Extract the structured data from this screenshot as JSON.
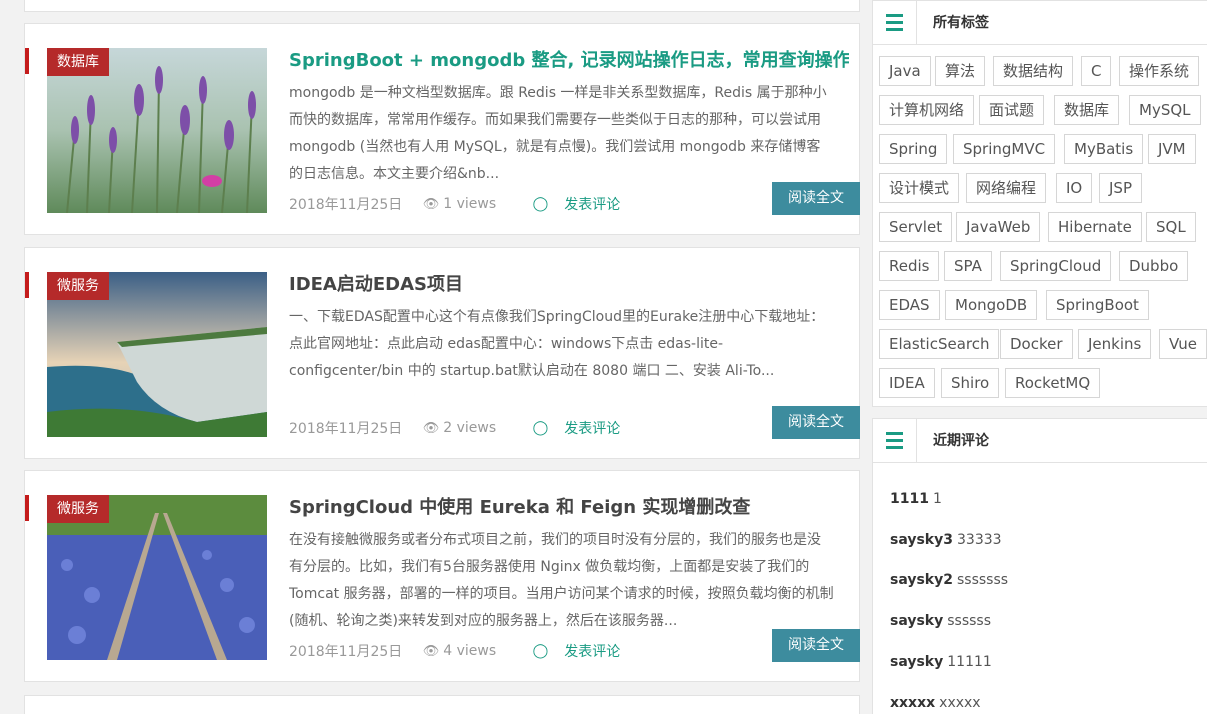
{
  "articles": [
    {
      "category": "数据库",
      "title": "SpringBoot + mongodb 整合, 记录网站操作日志，常用查询操作",
      "summary": "mongodb 是一种文档型数据库。跟 Redis 一样是非关系型数据库，Redis 属于那种小而快的数据库，常常用作缓存。而如果我们需要存一些类似于日志的那种，可以尝试用 mongodb (当然也有人用 MySQL，就是有点慢)。我们尝试用 mongodb 来存储博客的日志信息。本文主要介绍&nb...",
      "date": "2018年11月25日",
      "views": "1 views",
      "comment": "发表评论",
      "read": "阅读全文"
    },
    {
      "category": "微服务",
      "title": "IDEA启动EDAS项目",
      "summary": "一、下载EDAS配置中心这个有点像我们SpringCloud里的Eurake注册中心下载地址：点此官网地址：点此启动 edas配置中心：windows下点击 edas-lite-configcenter/bin 中的 startup.bat默认启动在 8080 端口 二、安装 Ali-To...",
      "date": "2018年11月25日",
      "views": "2 views",
      "comment": "发表评论",
      "read": "阅读全文"
    },
    {
      "category": "微服务",
      "title": "SpringCloud 中使用 Eureka 和 Feign 实现增删改查",
      "summary": "在没有接触微服务或者分布式项目之前，我们的项目时没有分层的，我们的服务也是没有分层的。比如，我们有5台服务器使用 Nginx 做负载均衡，上面都是安装了我们的 Tomcat 服务器，部署的一样的项目。当用户访问某个请求的时候，按照负载均衡的机制(随机、轮询之类)来转发到对应的服务器上，然后在该服务器...",
      "date": "2018年11月25日",
      "views": "4 views",
      "comment": "发表评论",
      "read": "阅读全文"
    }
  ],
  "tags_section": {
    "title": "所有标签",
    "tags": [
      "Java",
      "算法",
      "数据结构",
      "C",
      "操作系统",
      "计算机网络",
      "面试题",
      "数据库",
      "MySQL",
      "Spring",
      "SpringMVC",
      "MyBatis",
      "JVM",
      "设计模式",
      "网络编程",
      "IO",
      "JSP",
      "Servlet",
      "JavaWeb",
      "Hibernate",
      "SQL",
      "Redis",
      "SPA",
      "SpringCloud",
      "Dubbo",
      "EDAS",
      "MongoDB",
      "SpringBoot",
      "ElasticSearch",
      "Docker",
      "Jenkins",
      "Vue",
      "IDEA",
      "Shiro",
      "RocketMQ"
    ]
  },
  "comments_section": {
    "title": "近期评论",
    "items": [
      {
        "user": "1111",
        "text": "1"
      },
      {
        "user": "saysky3",
        "text": "33333"
      },
      {
        "user": "saysky2",
        "text": "sssssss"
      },
      {
        "user": "saysky",
        "text": "ssssss"
      },
      {
        "user": "saysky",
        "text": "11111"
      },
      {
        "user": "xxxxx",
        "text": "xxxxx"
      }
    ]
  },
  "colors": {
    "accent": "#1a9b83",
    "category_badge": "#b52a2a",
    "read_button": "#3d8c9e"
  }
}
